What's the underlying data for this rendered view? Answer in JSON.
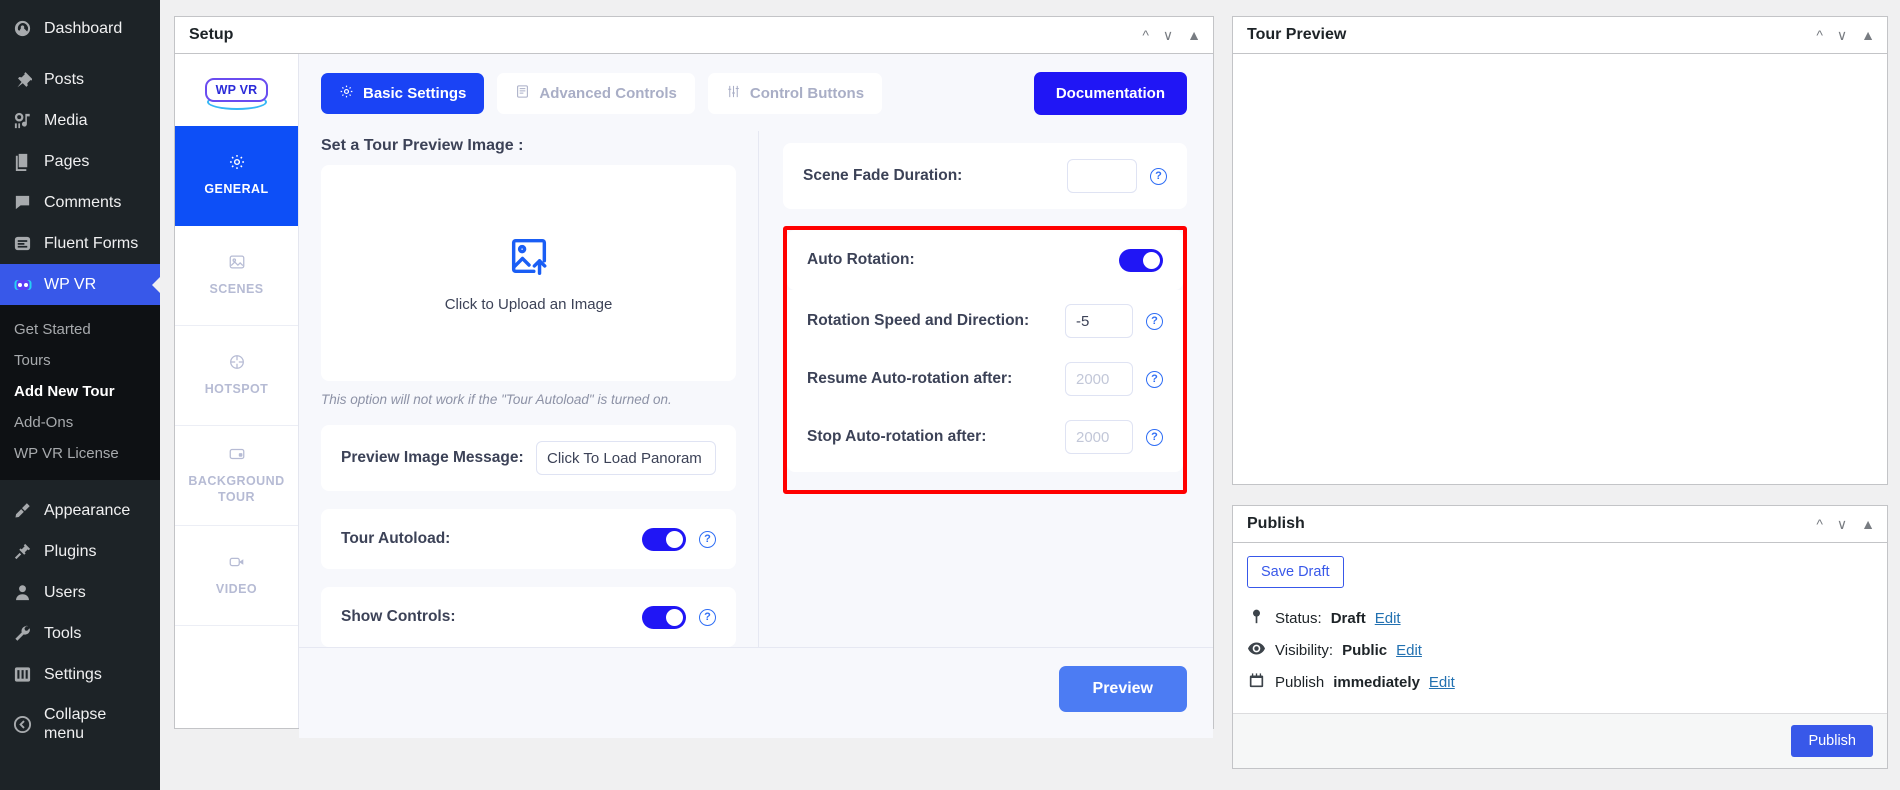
{
  "sidebar": {
    "items": [
      {
        "label": "Dashboard",
        "icon": "dashboard-icon"
      },
      {
        "label": "Posts",
        "icon": "pin-icon"
      },
      {
        "label": "Media",
        "icon": "media-icon"
      },
      {
        "label": "Pages",
        "icon": "pages-icon"
      },
      {
        "label": "Comments",
        "icon": "comments-icon"
      },
      {
        "label": "Fluent Forms",
        "icon": "form-icon"
      },
      {
        "label": "WP VR",
        "icon": "wpvr-icon"
      }
    ],
    "submenu": [
      {
        "label": "Get Started"
      },
      {
        "label": "Tours"
      },
      {
        "label": "Add New Tour"
      },
      {
        "label": "Add-Ons"
      },
      {
        "label": "WP VR License"
      }
    ],
    "bottom_items": [
      {
        "label": "Appearance",
        "icon": "brush-icon"
      },
      {
        "label": "Plugins",
        "icon": "plug-icon"
      },
      {
        "label": "Users",
        "icon": "user-icon"
      },
      {
        "label": "Tools",
        "icon": "wrench-icon"
      },
      {
        "label": "Settings",
        "icon": "settings-icon"
      },
      {
        "label": "Collapse menu",
        "icon": "collapse-icon"
      }
    ]
  },
  "setup": {
    "title": "Setup",
    "logo_text": "WP VR",
    "vtabs": [
      {
        "label": "GENERAL",
        "icon": "gear-icon"
      },
      {
        "label": "SCENES",
        "icon": "image-icon"
      },
      {
        "label": "HOTSPOT",
        "icon": "target-icon"
      },
      {
        "label": "BACKGROUND TOUR",
        "icon": "screen-icon"
      },
      {
        "label": "VIDEO",
        "icon": "video-icon"
      }
    ],
    "tabs": [
      {
        "label": "Basic Settings",
        "icon": "gear-icon"
      },
      {
        "label": "Advanced Controls",
        "icon": "list-icon"
      },
      {
        "label": "Control Buttons",
        "icon": "sliders-icon"
      }
    ],
    "documentation_label": "Documentation",
    "preview_label": "Preview",
    "preview_image": {
      "label": "Set a Tour Preview Image :",
      "upload_text": "Click to Upload an Image",
      "hint": "This option will not work if the \"Tour Autoload\" is turned on."
    },
    "preview_message": {
      "label": "Preview Image Message:",
      "value": "Click To Load Panoram"
    },
    "tour_autoload": {
      "label": "Tour Autoload:",
      "state": "on"
    },
    "show_controls": {
      "label": "Show Controls:",
      "state": "on"
    },
    "scene_fade": {
      "label": "Scene Fade Duration:",
      "value": "",
      "placeholder": ""
    },
    "auto_rotation": {
      "label": "Auto Rotation:",
      "state": "on"
    },
    "rotation_speed": {
      "label": "Rotation Speed and Direction:",
      "value": "-5",
      "placeholder": ""
    },
    "resume_rotation": {
      "label": "Resume Auto-rotation after:",
      "value": "",
      "placeholder": "2000"
    },
    "stop_rotation": {
      "label": "Stop Auto-rotation after:",
      "value": "",
      "placeholder": "2000"
    }
  },
  "tour_preview": {
    "title": "Tour Preview"
  },
  "publish": {
    "title": "Publish",
    "save_draft_label": "Save Draft",
    "status_label": "Status:",
    "status_value": "Draft",
    "visibility_label": "Visibility:",
    "visibility_value": "Public",
    "publish_label": "Publish",
    "publish_value": "immediately",
    "edit_label": "Edit",
    "publish_button": "Publish"
  },
  "colors": {
    "accent_blue": "#2016f5",
    "wp_blue": "#3858e9",
    "tab_blue": "#1a43f5",
    "highlight_red": "#ff0000",
    "preview_blue": "#4c7cf3"
  }
}
